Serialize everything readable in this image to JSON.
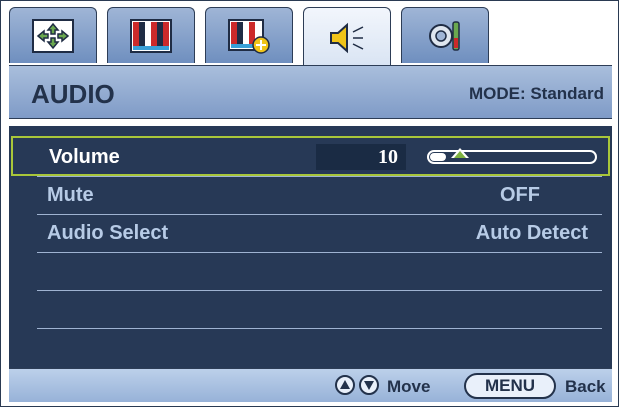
{
  "tabs": [
    {
      "icon": "display-adjust-icon"
    },
    {
      "icon": "picture-icon"
    },
    {
      "icon": "picture-advanced-icon"
    },
    {
      "icon": "speaker-icon",
      "active": true
    },
    {
      "icon": "system-settings-icon"
    }
  ],
  "header": {
    "title": "AUDIO",
    "mode": "MODE: Standard"
  },
  "items": {
    "volume": {
      "label": "Volume",
      "value": "10",
      "level": 0.1
    },
    "mute": {
      "label": "Mute",
      "value": "OFF"
    },
    "audio_select": {
      "label": "Audio Select",
      "value": "Auto Detect"
    }
  },
  "footer": {
    "move_label": "Move",
    "menu_label": "MENU",
    "back_label": "Back"
  },
  "colors": {
    "panel_bg": "#273956",
    "selection_border": "#a9c73a",
    "accent_green": "#7fb341"
  }
}
